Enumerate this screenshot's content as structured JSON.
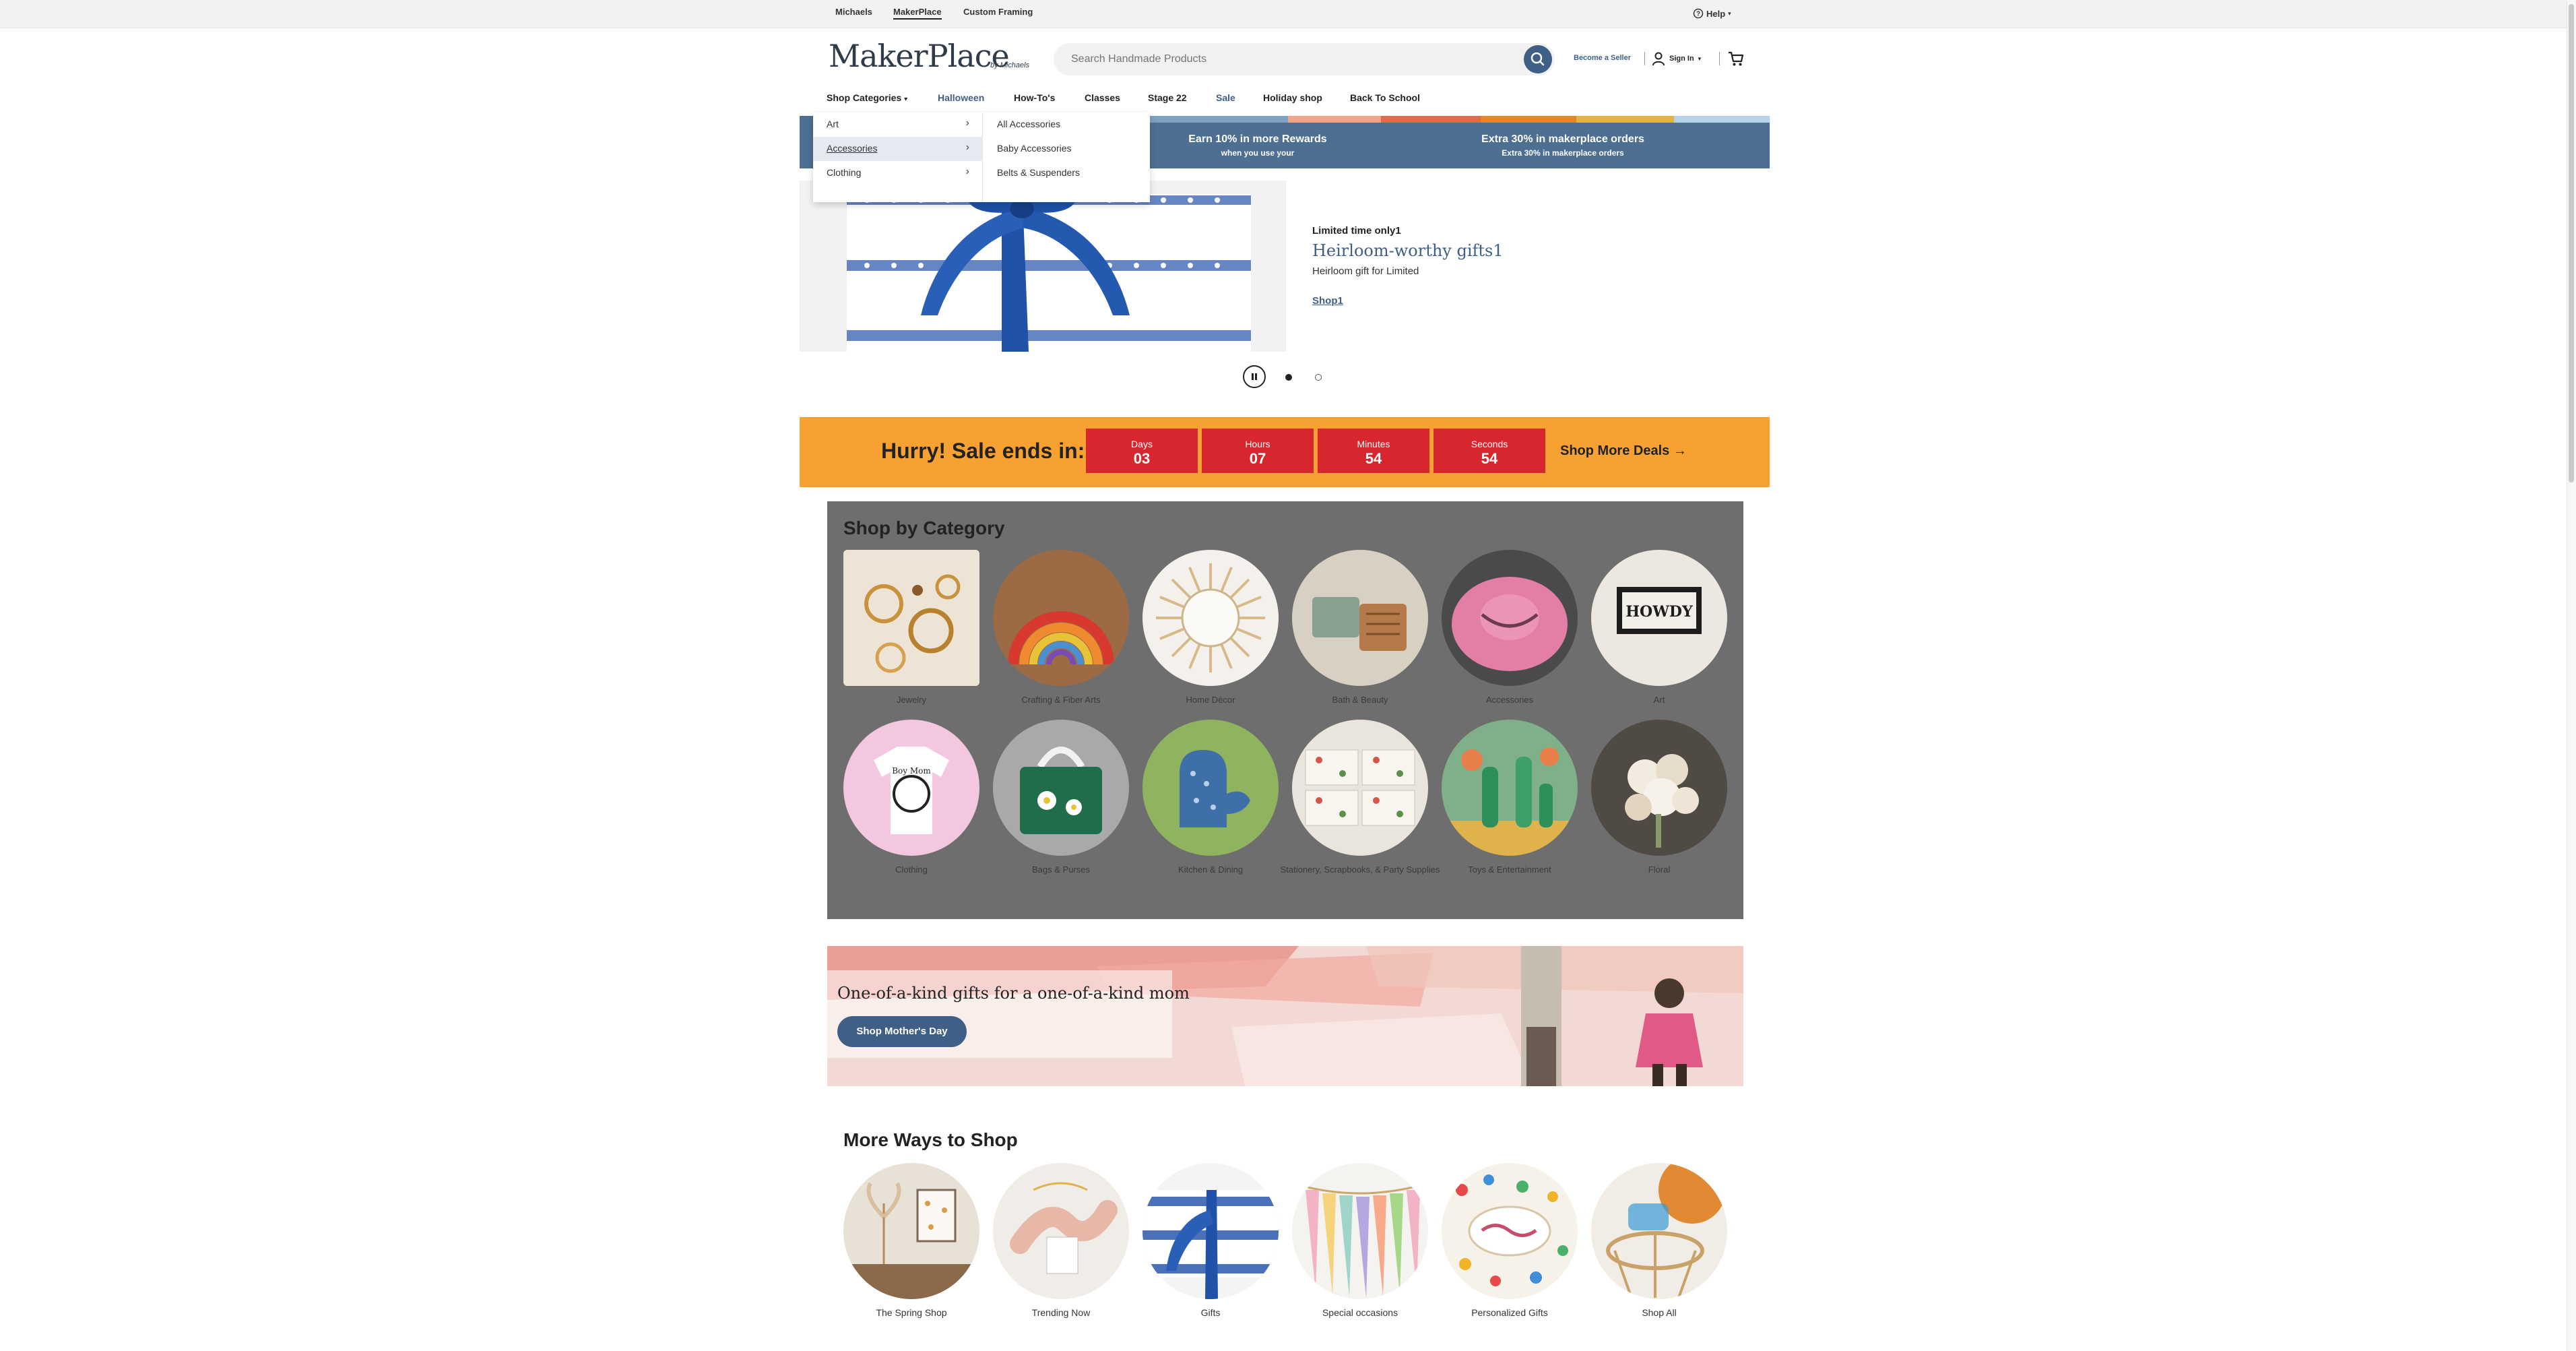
{
  "topbar": {
    "links": [
      "Michaels",
      "MakerPlace",
      "Custom Framing"
    ],
    "active": "MakerPlace",
    "help": "Help"
  },
  "header": {
    "logo": "MakerPlace",
    "logo_byline": "by Michaels",
    "search_placeholder": "Search Handmade Products",
    "become_seller": "Become a Seller",
    "sign_in": "Sign In"
  },
  "nav": {
    "items": [
      "Shop Categories",
      "Halloween",
      "How-To's",
      "Classes",
      "Stage 22",
      "Sale",
      "Holiday shop",
      "Back To School"
    ],
    "highlighted": [
      "Halloween",
      "Sale"
    ]
  },
  "dropdown": {
    "categories": [
      "Art",
      "Accessories",
      "Clothing"
    ],
    "selected": "Accessories",
    "subcategories": [
      "All Accessories",
      "Baby Accessories",
      "Belts & Suspenders"
    ]
  },
  "promo": [
    {
      "title": "Earn 10% in more Rewards",
      "subtitle": "when you use your"
    },
    {
      "title": "Extra 30% in makerplace orders",
      "subtitle": "Extra 30% in makerplace orders"
    }
  ],
  "hero": {
    "eyebrow": "Limited time only1",
    "title": "Heirloom-worthy gifts1",
    "subtitle": "Heirloom gift for Limited",
    "cta": "Shop1"
  },
  "carousel": {
    "active_index": 1,
    "count": 3
  },
  "sale": {
    "headline": "Hurry! Sale ends in:",
    "countdown": [
      {
        "label": "Days",
        "value": "03"
      },
      {
        "label": "Hours",
        "value": "07"
      },
      {
        "label": "Minutes",
        "value": "54"
      },
      {
        "label": "Seconds",
        "value": "54"
      }
    ],
    "cta": "Shop More Deals →"
  },
  "shop_by_category": {
    "title": "Shop by Category",
    "items": [
      "Jewelry",
      "Crafting & Fiber Arts",
      "Home Décor",
      "Bath & Beauty",
      "Accessories",
      "Art",
      "Clothing",
      "Bags & Purses",
      "Kitchen & Dining",
      "Stationery, Scrapbooks, & Party Supplies",
      "Toys & Entertainment",
      "Floral"
    ]
  },
  "mothers_day": {
    "headline": "One-of-a-kind gifts for a one-of-a-kind mom",
    "cta": "Shop Mother's Day"
  },
  "more_ways": {
    "title": "More Ways to Shop",
    "items": [
      "The Spring Shop",
      "Trending Now",
      "Gifts",
      "Special occasions",
      "Personalized Gifts",
      "Shop All"
    ]
  },
  "colors": {
    "brand_blue": "#3f5f86",
    "promo_blue": "#4d6f92",
    "sale_orange": "#f7a133",
    "countdown_red": "#d8262e",
    "category_panel": "#6e6e6e"
  },
  "icons": [
    "help-icon",
    "search-icon",
    "user-icon",
    "cart-icon",
    "chevron-right-icon",
    "caret-down-icon"
  ]
}
